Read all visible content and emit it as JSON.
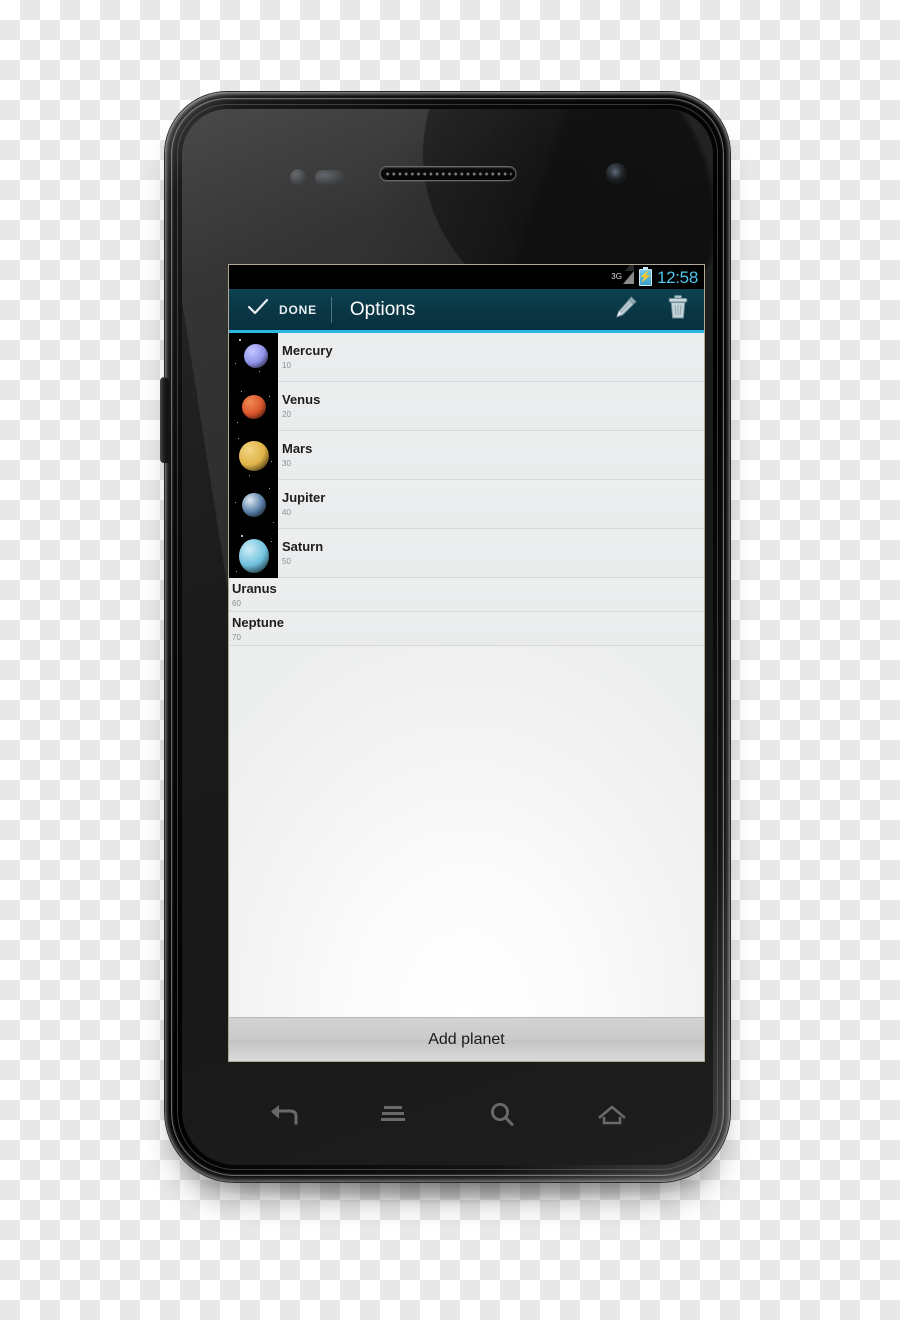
{
  "device": {
    "name": "android-smartphone",
    "hardware": {
      "earpiece": "earpiece-speaker",
      "front_camera": "front-camera",
      "proximity_sensor": "proximity-sensor",
      "light_sensor": "light-sensor",
      "volume_rocker": "volume-rocker"
    },
    "nav_buttons": [
      {
        "name": "back-button",
        "glyph": "back"
      },
      {
        "name": "menu-button",
        "glyph": "menu"
      },
      {
        "name": "search-button",
        "glyph": "search"
      },
      {
        "name": "home-button",
        "glyph": "home"
      }
    ]
  },
  "status_bar": {
    "network_type": "3G",
    "signal_icon": "signal-triangle-icon",
    "battery_icon": "battery-charging-icon",
    "battery_glyph": "⚡",
    "clock": "12:58"
  },
  "action_bar": {
    "done_label": "DONE",
    "check_icon": "check-icon",
    "title": "Options",
    "edit_icon": "pencil-icon",
    "delete_icon": "trash-icon",
    "background_color": "#0a3644",
    "accent_color": "#29b6e0",
    "title_color": "#ffffff"
  },
  "list": {
    "items": [
      {
        "title": "Mercury",
        "subtitle": "10",
        "has_thumb": true,
        "thumb": "planet-thumb-mercury",
        "color": "#8f92e8",
        "highlight": "#c5c8ff"
      },
      {
        "title": "Venus",
        "subtitle": "20",
        "has_thumb": true,
        "thumb": "planet-thumb-venus",
        "color": "#d9552c",
        "highlight": "#f08b55"
      },
      {
        "title": "Mars",
        "subtitle": "30",
        "has_thumb": true,
        "thumb": "planet-thumb-mars",
        "color": "#e0b347",
        "highlight": "#f2d584"
      },
      {
        "title": "Jupiter",
        "subtitle": "40",
        "has_thumb": true,
        "thumb": "planet-thumb-jupiter",
        "color": "#5a7fa8",
        "highlight": "#dfeaf5"
      },
      {
        "title": "Saturn",
        "subtitle": "50",
        "has_thumb": true,
        "thumb": "planet-thumb-saturn",
        "color": "#6fc0dd",
        "highlight": "#cfeef8"
      },
      {
        "title": "Uranus",
        "subtitle": "60",
        "has_thumb": false,
        "thumb": "",
        "color": "",
        "highlight": ""
      },
      {
        "title": "Neptune",
        "subtitle": "70",
        "has_thumb": false,
        "thumb": "",
        "color": "",
        "highlight": ""
      }
    ]
  },
  "footer": {
    "add_button_label": "Add planet"
  }
}
